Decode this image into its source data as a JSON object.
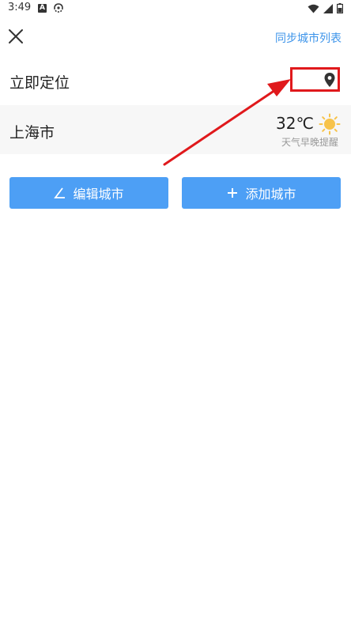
{
  "status_bar": {
    "time": "3:49",
    "left_icons": [
      "accessibility-a-icon",
      "sync-loop-icon"
    ],
    "right_icons": [
      "wifi-icon",
      "signal-icon",
      "battery-icon"
    ]
  },
  "header": {
    "close_icon": "close-x-icon",
    "sync_label": "同步城市列表"
  },
  "locate": {
    "label": "立即定位",
    "icon": "location-pin-icon"
  },
  "city": {
    "name": "上海市",
    "temperature": "32℃",
    "weather_icon": "sun-icon",
    "tip": "天气早晚提醒"
  },
  "actions": {
    "edit_label": "编辑城市",
    "add_label": "添加城市"
  },
  "colors": {
    "accent": "#3d94ea",
    "button": "#4d9ff5",
    "annotation": "#e0191c",
    "sun": "#f7c34a"
  }
}
